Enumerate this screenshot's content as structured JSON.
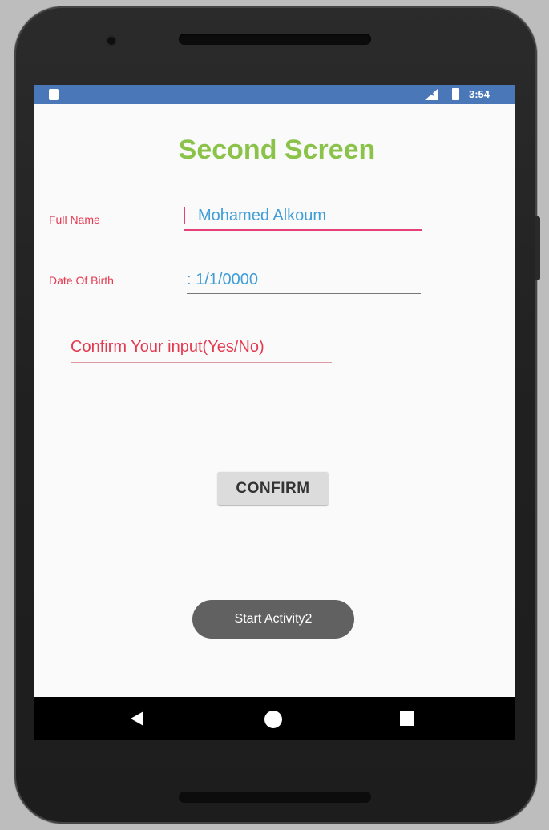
{
  "status_bar": {
    "time": "3:54",
    "icons": [
      "sim-card-icon",
      "signal-icon",
      "battery-icon"
    ]
  },
  "screen": {
    "title": "Second Screen",
    "full_name_label": "Full Name",
    "full_name_value": "Mohamed Alkoum",
    "dob_label": "Date Of Birth",
    "dob_value": ": 1/1/0000",
    "confirm_input_text": "Confirm Your input(Yes/No)",
    "confirm_button": "CONFIRM",
    "start_button": "Start Activity2"
  },
  "nav_bar": {
    "icons": [
      "back-icon",
      "home-icon",
      "recents-icon"
    ]
  },
  "colors": {
    "status_bar": "#4a77b8",
    "title": "#8bc34a",
    "label": "#e53950",
    "input_text": "#3f9ed8",
    "accent_underline": "#e5407a"
  }
}
